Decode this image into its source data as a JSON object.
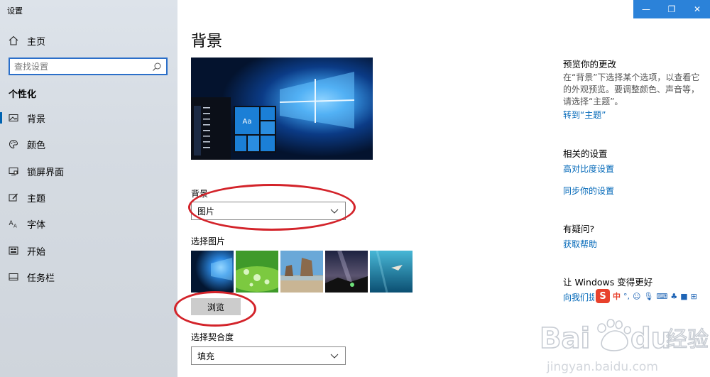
{
  "window": {
    "title": "设置"
  },
  "sidebar": {
    "home_label": "主页",
    "search_placeholder": "查找设置",
    "section_label": "个性化",
    "items": [
      {
        "label": "背景",
        "icon": "picture-icon",
        "active": true
      },
      {
        "label": "颜色",
        "icon": "palette-icon",
        "active": false
      },
      {
        "label": "锁屏界面",
        "icon": "lock-screen-icon",
        "active": false
      },
      {
        "label": "主题",
        "icon": "theme-icon",
        "active": false
      },
      {
        "label": "字体",
        "icon": "font-icon",
        "active": false
      },
      {
        "label": "开始",
        "icon": "start-icon",
        "active": false
      },
      {
        "label": "任务栏",
        "icon": "taskbar-icon",
        "active": false
      }
    ]
  },
  "main": {
    "title": "背景",
    "background_label": "背景",
    "background_value": "图片",
    "choose_picture_label": "选择图片",
    "browse_label": "浏览",
    "fit_label": "选择契合度",
    "fit_value": "填充",
    "preview_tile_text": "Aa"
  },
  "right": {
    "preview_heading": "预览你的更改",
    "preview_text": "在“背景”下选择某个选项，以查看它的外观预览。要调整颜色、声音等，请选择“主题”。",
    "preview_link": "转到“主题”",
    "related_heading": "相关的设置",
    "related_links": [
      "高对比度设置",
      "同步你的设置"
    ],
    "question_heading": "有疑问?",
    "help_link": "获取帮助",
    "improve_heading": "让 Windows 变得更好",
    "feedback_link": "向我们提"
  },
  "ime": {
    "mode_char": "中",
    "punct": "°,"
  },
  "watermark": {
    "text": "Baidu经验",
    "url_text": "jingyan.baidu.com"
  },
  "colors": {
    "accent": "#0067b8",
    "titlebar": "#2b82d9",
    "annotation": "#d3232a"
  }
}
